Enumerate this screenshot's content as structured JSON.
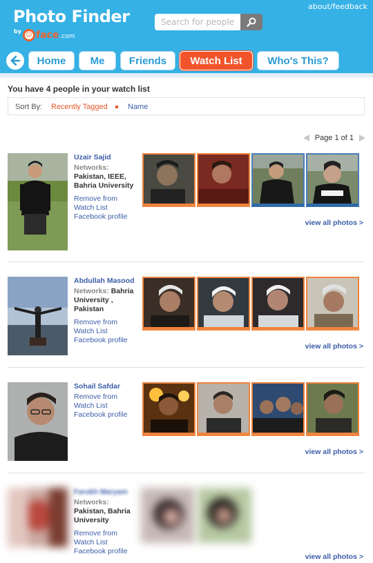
{
  "header": {
    "logo_title": "Photo Finder",
    "logo_by": "by",
    "logo_brand": "face",
    "logo_tld": ".com",
    "search_placeholder": "Search for people",
    "about_link": "about/feedback"
  },
  "nav": {
    "tabs": [
      {
        "label": "Home",
        "active": false
      },
      {
        "label": "Me",
        "active": false
      },
      {
        "label": "Friends",
        "active": false
      },
      {
        "label": "Watch List",
        "active": true
      },
      {
        "label": "Who's This?",
        "active": false
      }
    ]
  },
  "watchlist": {
    "title": "You have 4 people in your watch list",
    "sort_label": "Sort By:",
    "sort_options": [
      "Recently Tagged",
      "Name"
    ],
    "pager": "Page 1 of 1"
  },
  "people": [
    {
      "name": "Uzair Sajid",
      "networks_label": "Networks:",
      "networks": "Pakistan, IEEE, Bahria University",
      "links": [
        "Remove from Watch List",
        "Facebook profile"
      ],
      "view_all": "view all photos >"
    },
    {
      "name": "Abdullah Masood",
      "networks_label": "Networks:",
      "networks": "Bahria University , Pakistan",
      "links": [
        "Remove from Watch List",
        "Facebook profile"
      ],
      "view_all": "view all photos >"
    },
    {
      "name": "Sohail Safdar",
      "links": [
        "Remove from Watch List",
        "Facebook profile"
      ],
      "view_all": "view all photos >"
    },
    {
      "name": "Farukh Maryam",
      "networks_label": "Networks:",
      "networks": "Pakistan, Bahria University",
      "links": [
        "Remove from Watch List",
        "Facebook profile"
      ],
      "view_all": "view all photos >"
    }
  ],
  "colors": {
    "header_bg": "#35b1e6",
    "accent_orange": "#f1542b",
    "link_blue": "#3b5ca8"
  }
}
